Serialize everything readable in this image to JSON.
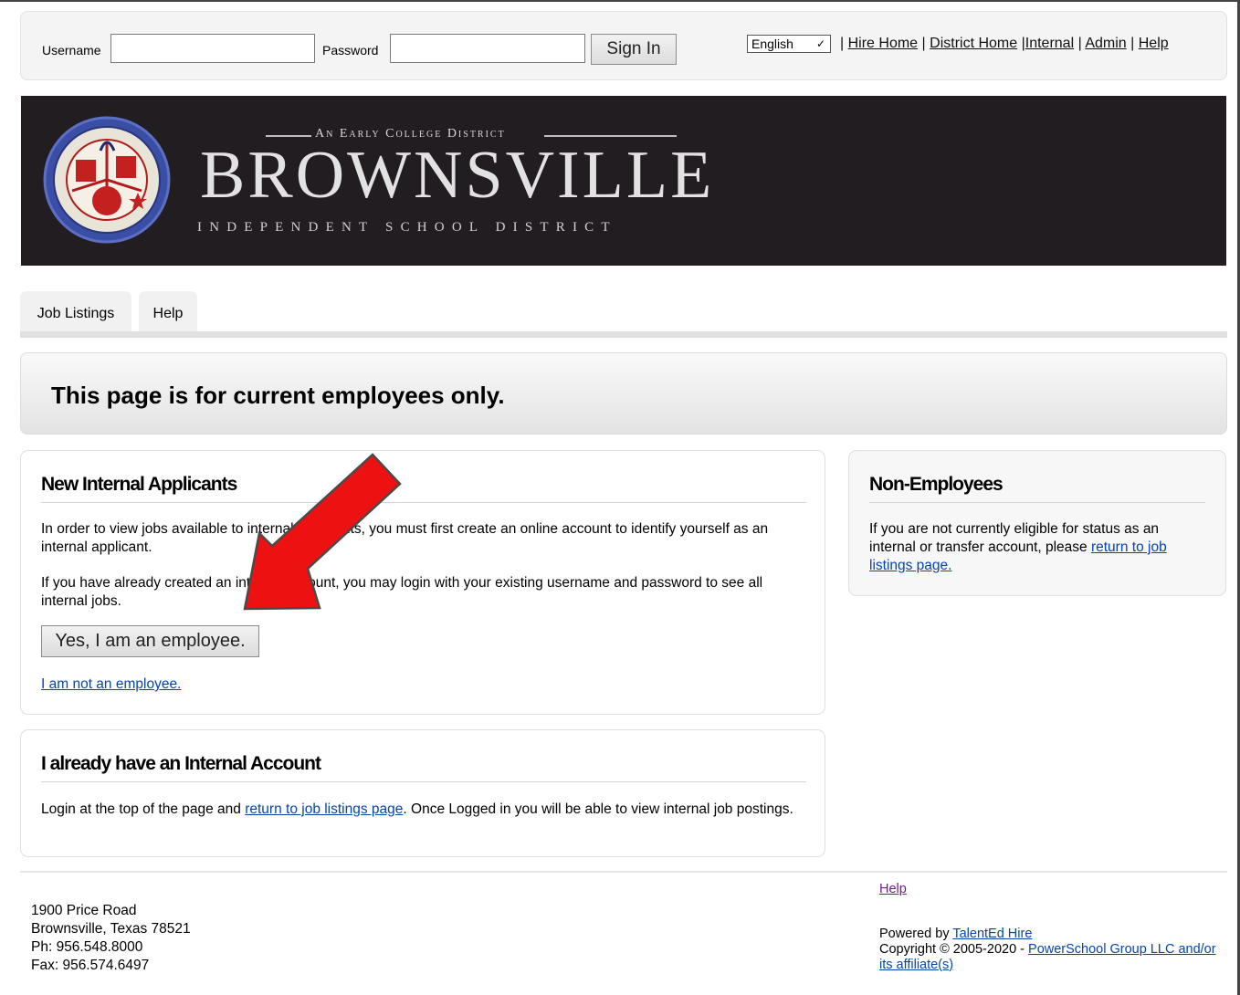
{
  "login": {
    "username_label": "Username",
    "username_value": "",
    "password_label": "Password",
    "password_value": "",
    "sign_in": "Sign In",
    "language": "English"
  },
  "toplinks": {
    "sep1": "|",
    "hire_home": "Hire Home",
    "sep2": "|",
    "district_home": "District Home",
    "sep3": "|",
    "internal": "Internal",
    "sep4": "|",
    "admin": "Admin",
    "sep5": "|",
    "help": "Help"
  },
  "banner": {
    "subtitle": "An Early College District",
    "title": "BROWNSVILLE",
    "district": "INDEPENDENT SCHOOL DISTRICT",
    "seal_text": "BROWNSVILLE INDEPENDENT SCHOOL DISTRICT · BROWNSVILLE, TEXAS"
  },
  "tabs": [
    {
      "label": "Job Listings"
    },
    {
      "label": "Help"
    }
  ],
  "notice": "This page is for current employees only.",
  "new_internal": {
    "heading": "New Internal Applicants",
    "para1": "In order to view jobs available to internal applicants, you must first create an online account to identify yourself as an internal applicant.",
    "para2": "If you have already created an internal account, you may login with your existing username and password to see all internal jobs.",
    "yes_button": "Yes, I am an employee.",
    "not_link": "I am not an employee."
  },
  "have_account": {
    "heading": "I already have an Internal Account",
    "text_before": "Login at the top of the page and ",
    "link": "return to job listings page",
    "text_after": ". Once Logged in you will be able to view internal job postings."
  },
  "non_employees": {
    "heading": "Non-Employees",
    "text_before": "If you are not currently eligible for status as an internal or transfer account, please ",
    "link": "return to job listings page."
  },
  "footer": {
    "address1": "1900 Price Road",
    "address2": "Brownsville, Texas 78521",
    "phone": "Ph: 956.548.8000",
    "fax": "Fax: 956.574.6497",
    "help": "Help",
    "powered_prefix": "Powered by ",
    "powered_link": "TalentEd Hire",
    "copyright_prefix": "Copyright © 2005-2020  - ",
    "copyright_link": "PowerSchool Group LLC and/or its affiliate(s)"
  },
  "colors": {
    "banner_bg": "#221d21",
    "link": "#0645ad",
    "arrow": "#ee1111"
  }
}
